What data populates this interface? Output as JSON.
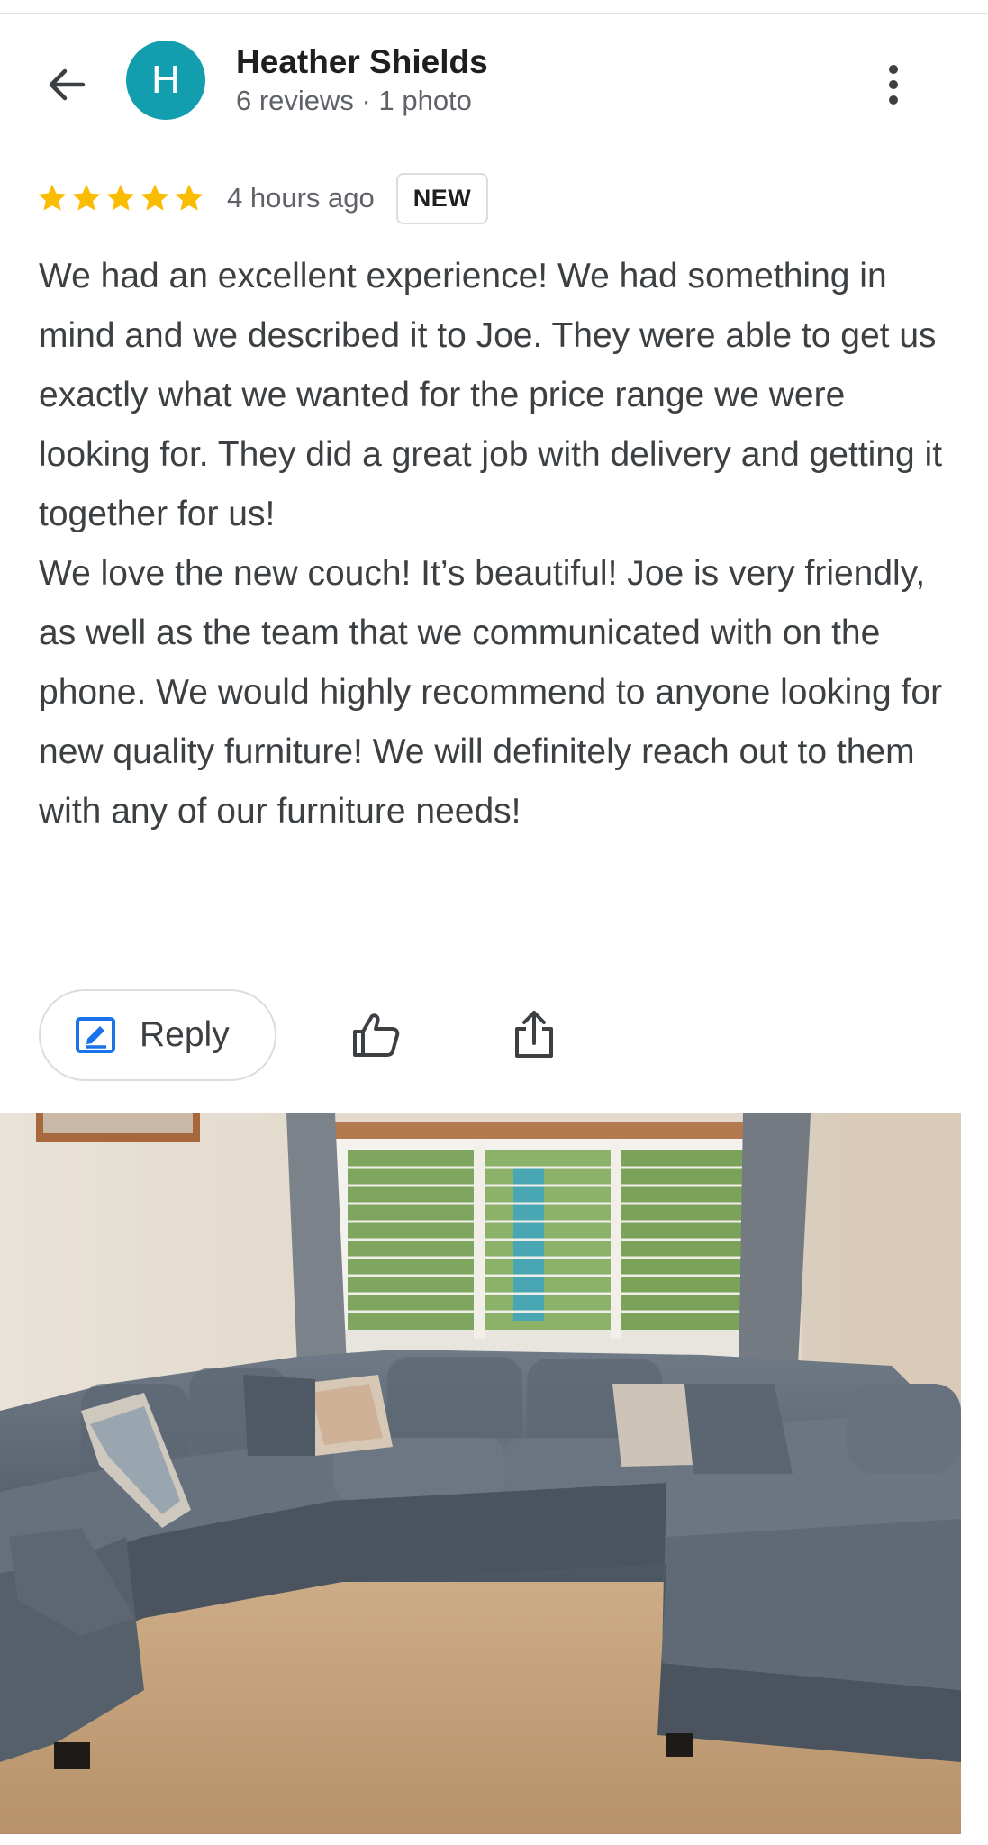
{
  "reviewer": {
    "initial": "H",
    "name": "Heather Shields",
    "meta": "6 reviews · 1 photo",
    "avatar_color": "#129eaf"
  },
  "rating": {
    "stars": 5,
    "max_stars": 5,
    "star_color": "#fbbc04",
    "time": "4 hours ago",
    "badge": "NEW"
  },
  "review": {
    "paragraphs": [
      "We had an excellent experience! We had something in mind and we described it to Joe. They were able to get us exactly what we wanted for the price range we were looking for. They did a great job with delivery and getting it together for us!",
      "We love the new couch! It’s beautiful! Joe is very friendly, as well as the team that we communicated with on the phone. We would highly recommend to anyone looking for new quality furniture! We will definitely reach out to them with any of our furniture needs!"
    ]
  },
  "actions": {
    "reply_label": "Reply",
    "accent_color": "#1a73e8"
  },
  "icons": {
    "back": "arrow-back-icon",
    "more": "more-vert-icon",
    "reply": "edit-reply-icon",
    "like": "thumb-up-icon",
    "share": "share-icon"
  }
}
